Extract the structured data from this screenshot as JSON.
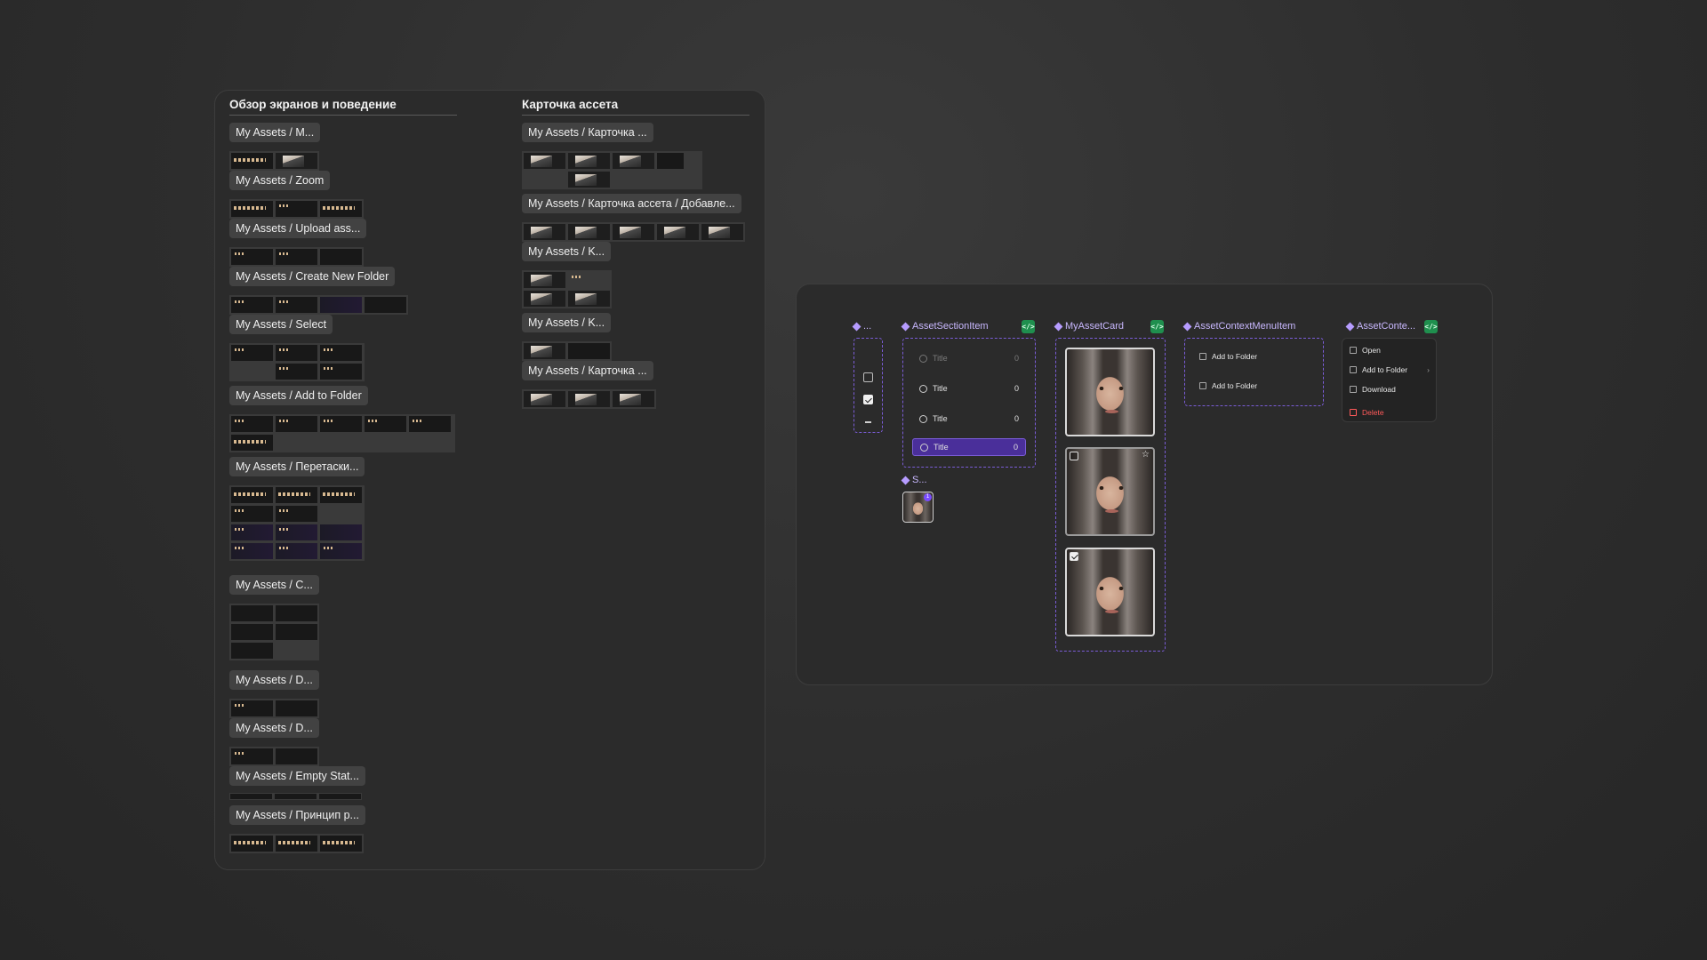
{
  "left_panel": {
    "section1_title": "Обзор экранов и поведение",
    "section2_title": "Карточка ассета",
    "section1_items": [
      "My Assets / M...",
      "My Assets / Zoom",
      "My Assets / Upload ass...",
      "My Assets / Create New Folder",
      "My Assets / Select",
      "My Assets / Add to Folder",
      "My Assets / Перетаски...",
      "My Assets / C...",
      "My Assets / D...",
      "My Assets / D...",
      "My Assets / Empty Stat...",
      "My Assets / Принцип р..."
    ],
    "section2_items": [
      "My Assets / Карточка ...",
      "My Assets / Карточка ассета / Добавле...",
      "My Assets / K...",
      "My Assets / K...",
      "My Assets / Карточка ..."
    ]
  },
  "right_panel": {
    "checkbox_component": "...",
    "section_item_component": "AssetSectionItem",
    "section_items": [
      {
        "title": "Title",
        "count": "0",
        "state": "disabled"
      },
      {
        "title": "Title",
        "count": "0",
        "state": "default"
      },
      {
        "title": "Title",
        "count": "0",
        "state": "default"
      },
      {
        "title": "Title",
        "count": "0",
        "state": "active"
      }
    ],
    "small_component": "S...",
    "small_badge": "1",
    "asset_card_component": "MyAssetCard",
    "context_menu_item_component": "AssetContextMenuItem",
    "context_menu_items": [
      "Add to Folder",
      "Add to Folder"
    ],
    "context_menu_component": "AssetConte...",
    "context_menu": [
      "Open",
      "Add to Folder",
      "Download",
      "Delete"
    ],
    "code_icon": "</>"
  },
  "colors": {
    "accent_purple": "#7a5cd6",
    "active_purple": "#4a2f9a",
    "code_green": "#1f8f4e",
    "danger_red": "#ff5a5a"
  }
}
